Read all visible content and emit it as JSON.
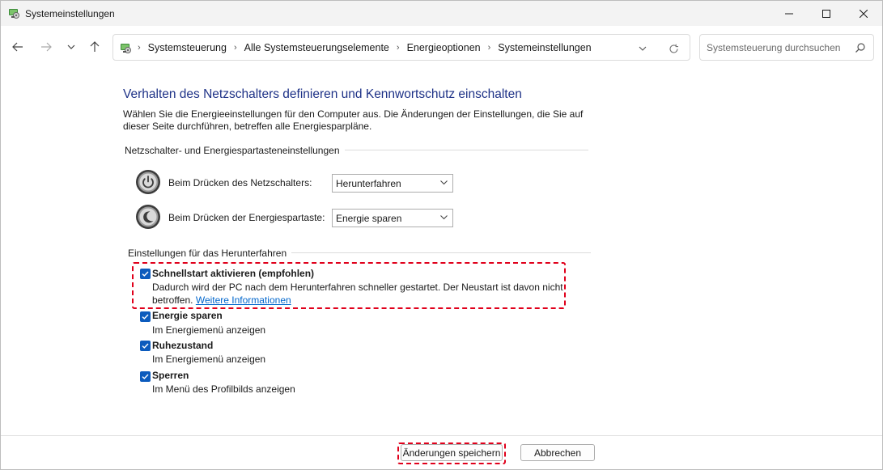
{
  "window": {
    "title": "Systemeinstellungen"
  },
  "nav": {
    "breadcrumbs": [
      "Systemsteuerung",
      "Alle Systemsteuerungselemente",
      "Energieoptionen",
      "Systemeinstellungen"
    ],
    "search_placeholder": "Systemsteuerung durchsuchen"
  },
  "main": {
    "title": "Verhalten des Netzschalters definieren und Kennwortschutz einschalten",
    "intro": "Wählen Sie die Energieeinstellungen für den Computer aus. Die Änderungen der Einstellungen, die Sie auf dieser Seite durchführen, betreffen alle Energiesparpläne.",
    "buttons_group": {
      "header": "Netzschalter- und Energiespartasteneinstellungen",
      "rows": [
        {
          "label": "Beim Drücken des Netzschalters:",
          "value": "Herunterfahren"
        },
        {
          "label": "Beim Drücken der Energiespartaste:",
          "value": "Energie sparen"
        }
      ]
    },
    "shutdown_group": {
      "header": "Einstellungen für das Herunterfahren",
      "options": [
        {
          "title": "Schnellstart aktivieren (empfohlen)",
          "desc": "Dadurch wird der PC nach dem Herunterfahren schneller gestartet. Der Neustart ist davon nicht betroffen.",
          "link": "Weitere Informationen",
          "checked": true
        },
        {
          "title": "Energie sparen",
          "desc": "Im Energiemenü anzeigen",
          "checked": true
        },
        {
          "title": "Ruhezustand",
          "desc": "Im Energiemenü anzeigen",
          "checked": true
        },
        {
          "title": "Sperren",
          "desc": "Im Menü des Profilbilds anzeigen",
          "checked": true
        }
      ]
    }
  },
  "footer": {
    "save_label": "Änderungen speichern",
    "cancel_label": "Abbrechen"
  },
  "colors": {
    "title_blue": "#1e3287",
    "checkbox_blue": "#0c5bbd",
    "link_blue": "#0066cc",
    "highlight_red": "#e0001b"
  }
}
